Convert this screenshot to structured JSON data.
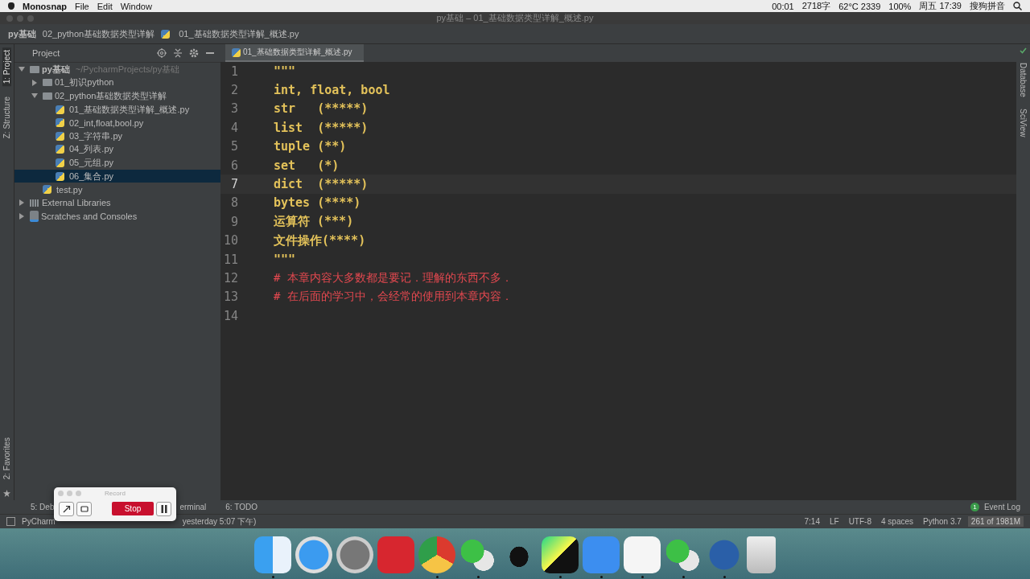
{
  "menu_bar": {
    "app": "Monosnap",
    "menus": [
      "File",
      "Edit",
      "Window"
    ],
    "status": [
      "00:01",
      "2718字",
      "62°C 2339",
      "100%",
      "周五 17:39",
      "搜狗拼音"
    ]
  },
  "window_title": "py基础 – 01_基础数据类型详解_概述.py",
  "breadcrumbs": [
    "py基础",
    "02_python基础数据类型详解",
    "01_基础数据类型详解_概述.py"
  ],
  "left_stripe": [
    {
      "label": "1: Project",
      "selected": true
    },
    {
      "label": "Z: Structure",
      "selected": false
    }
  ],
  "favorites": "2: Favorites",
  "project_panel": {
    "title": "Project",
    "tree": [
      {
        "kind": "folder",
        "label": "py基础",
        "path": "~/PycharmProjects/py基础",
        "expanded": true,
        "selected": false,
        "children": [
          {
            "kind": "folder",
            "label": "01_初识python",
            "expanded": false,
            "selected": false
          },
          {
            "kind": "folder",
            "label": "02_python基础数据类型详解",
            "expanded": true,
            "selected": false,
            "children": [
              {
                "kind": "pyfile",
                "label": "01_基础数据类型详解_概述.py",
                "selected": false
              },
              {
                "kind": "pyfile",
                "label": "02_int,float,bool.py",
                "selected": false
              },
              {
                "kind": "pyfile",
                "label": "03_字符串.py",
                "selected": false
              },
              {
                "kind": "pyfile",
                "label": "04_列表.py",
                "selected": false
              },
              {
                "kind": "pyfile",
                "label": "05_元组.py",
                "selected": false
              },
              {
                "kind": "pyfile",
                "label": "06_集合.py",
                "selected": true
              }
            ]
          },
          {
            "kind": "pyfile",
            "label": "test.py",
            "selected": false
          }
        ]
      },
      {
        "kind": "libs",
        "label": "External Libraries",
        "expanded": false,
        "selected": false
      },
      {
        "kind": "scratch",
        "label": "Scratches and Consoles",
        "expanded": false,
        "selected": false
      }
    ]
  },
  "editor_tab": "01_基础数据类型详解_概述.py",
  "right_stripe": [
    "Database",
    "SciView"
  ],
  "code": [
    {
      "number": "1",
      "kind": "string",
      "text": "\"\"\"",
      "current": false
    },
    {
      "number": "2",
      "kind": "string",
      "text": "int, float, bool",
      "current": false
    },
    {
      "number": "3",
      "kind": "string",
      "text": "str   (*****)",
      "current": false
    },
    {
      "number": "4",
      "kind": "string",
      "text": "list  (*****)",
      "current": false
    },
    {
      "number": "5",
      "kind": "string",
      "text": "tuple (**)",
      "current": false
    },
    {
      "number": "6",
      "kind": "string",
      "text": "set   (*)",
      "current": false
    },
    {
      "number": "7",
      "kind": "string",
      "text": "dict  (*****)",
      "current": true
    },
    {
      "number": "8",
      "kind": "string",
      "text": "bytes (****)",
      "current": false
    },
    {
      "number": "9",
      "kind": "string",
      "text": "运算符 (***)",
      "current": false
    },
    {
      "number": "10",
      "kind": "string",
      "text": "文件操作(****)",
      "current": false
    },
    {
      "number": "11",
      "kind": "string",
      "text": "\"\"\"",
      "current": false
    },
    {
      "number": "12",
      "kind": "comment",
      "text": "# 本章内容大多数都是要记．理解的东西不多．",
      "current": false
    },
    {
      "number": "13",
      "kind": "comment",
      "text": "# 在后面的学习中，会经常的使用到本章内容．",
      "current": false
    },
    {
      "number": "14",
      "kind": "blank",
      "current": false
    }
  ],
  "tool_windows": [
    "5: Deb",
    "erminal",
    "6: TODO"
  ],
  "event_log": {
    "label": "Event Log",
    "count": "1"
  },
  "status_bar": {
    "left": [
      "PyCharm",
      "yesterday 5:07 下午)"
    ],
    "right": [
      "7:14",
      "LF",
      "UTF-8",
      "4 spaces",
      "Python 3.7"
    ],
    "memory": "261 of 1981M"
  },
  "record_window": {
    "title": "Record",
    "stop": "Stop"
  },
  "dock": [
    {
      "kind": "finder",
      "running": true
    },
    {
      "kind": "safari",
      "running": false
    },
    {
      "kind": "launchpad",
      "running": false
    },
    {
      "kind": "music",
      "running": false
    },
    {
      "kind": "chrome",
      "running": true
    },
    {
      "kind": "wechat",
      "running": true
    },
    {
      "kind": "qq",
      "running": false
    },
    {
      "kind": "pycharm",
      "running": true
    },
    {
      "kind": "notes",
      "running": true
    },
    {
      "kind": "cloud",
      "running": true
    },
    {
      "kind": "wechat",
      "running": true
    },
    {
      "kind": "bolt",
      "running": true
    },
    {
      "kind": "trash",
      "running": false
    }
  ]
}
